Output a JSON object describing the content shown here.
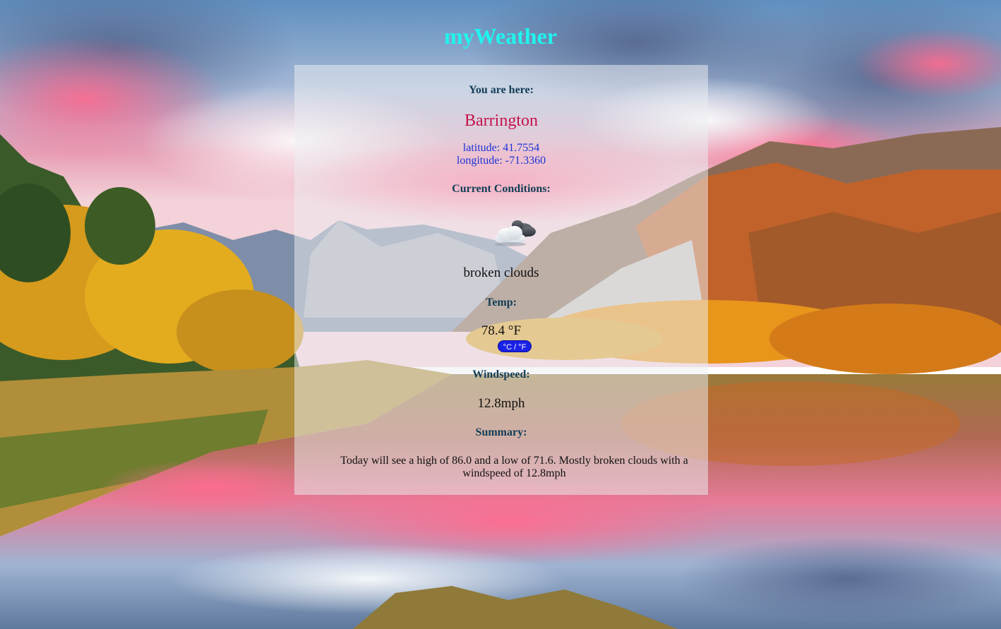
{
  "app": {
    "title": "myWeather"
  },
  "location": {
    "heading": "You are here:",
    "city": "Barrington",
    "latitude": "latitude: 41.7554",
    "longitude": "longitude: -71.3360"
  },
  "conditions": {
    "heading": "Current Conditions:",
    "icon": "cloud-sun-icon",
    "description": "broken clouds"
  },
  "temperature": {
    "heading": "Temp:",
    "value": "78.4 °F",
    "toggle_label": "°C / °F"
  },
  "wind": {
    "heading": "Windspeed:",
    "value": "12.8mph"
  },
  "summary": {
    "heading": "Summary:",
    "text": "Today will see a high of 86.0 and a low of 71.6. Mostly broken clouds with a windspeed of 12.8mph"
  },
  "colors": {
    "title": "#1ff5ee",
    "city": "#c4134a",
    "coordinates": "#1a33d6",
    "headings": "#123d55",
    "toggle": "#1a22e6"
  }
}
